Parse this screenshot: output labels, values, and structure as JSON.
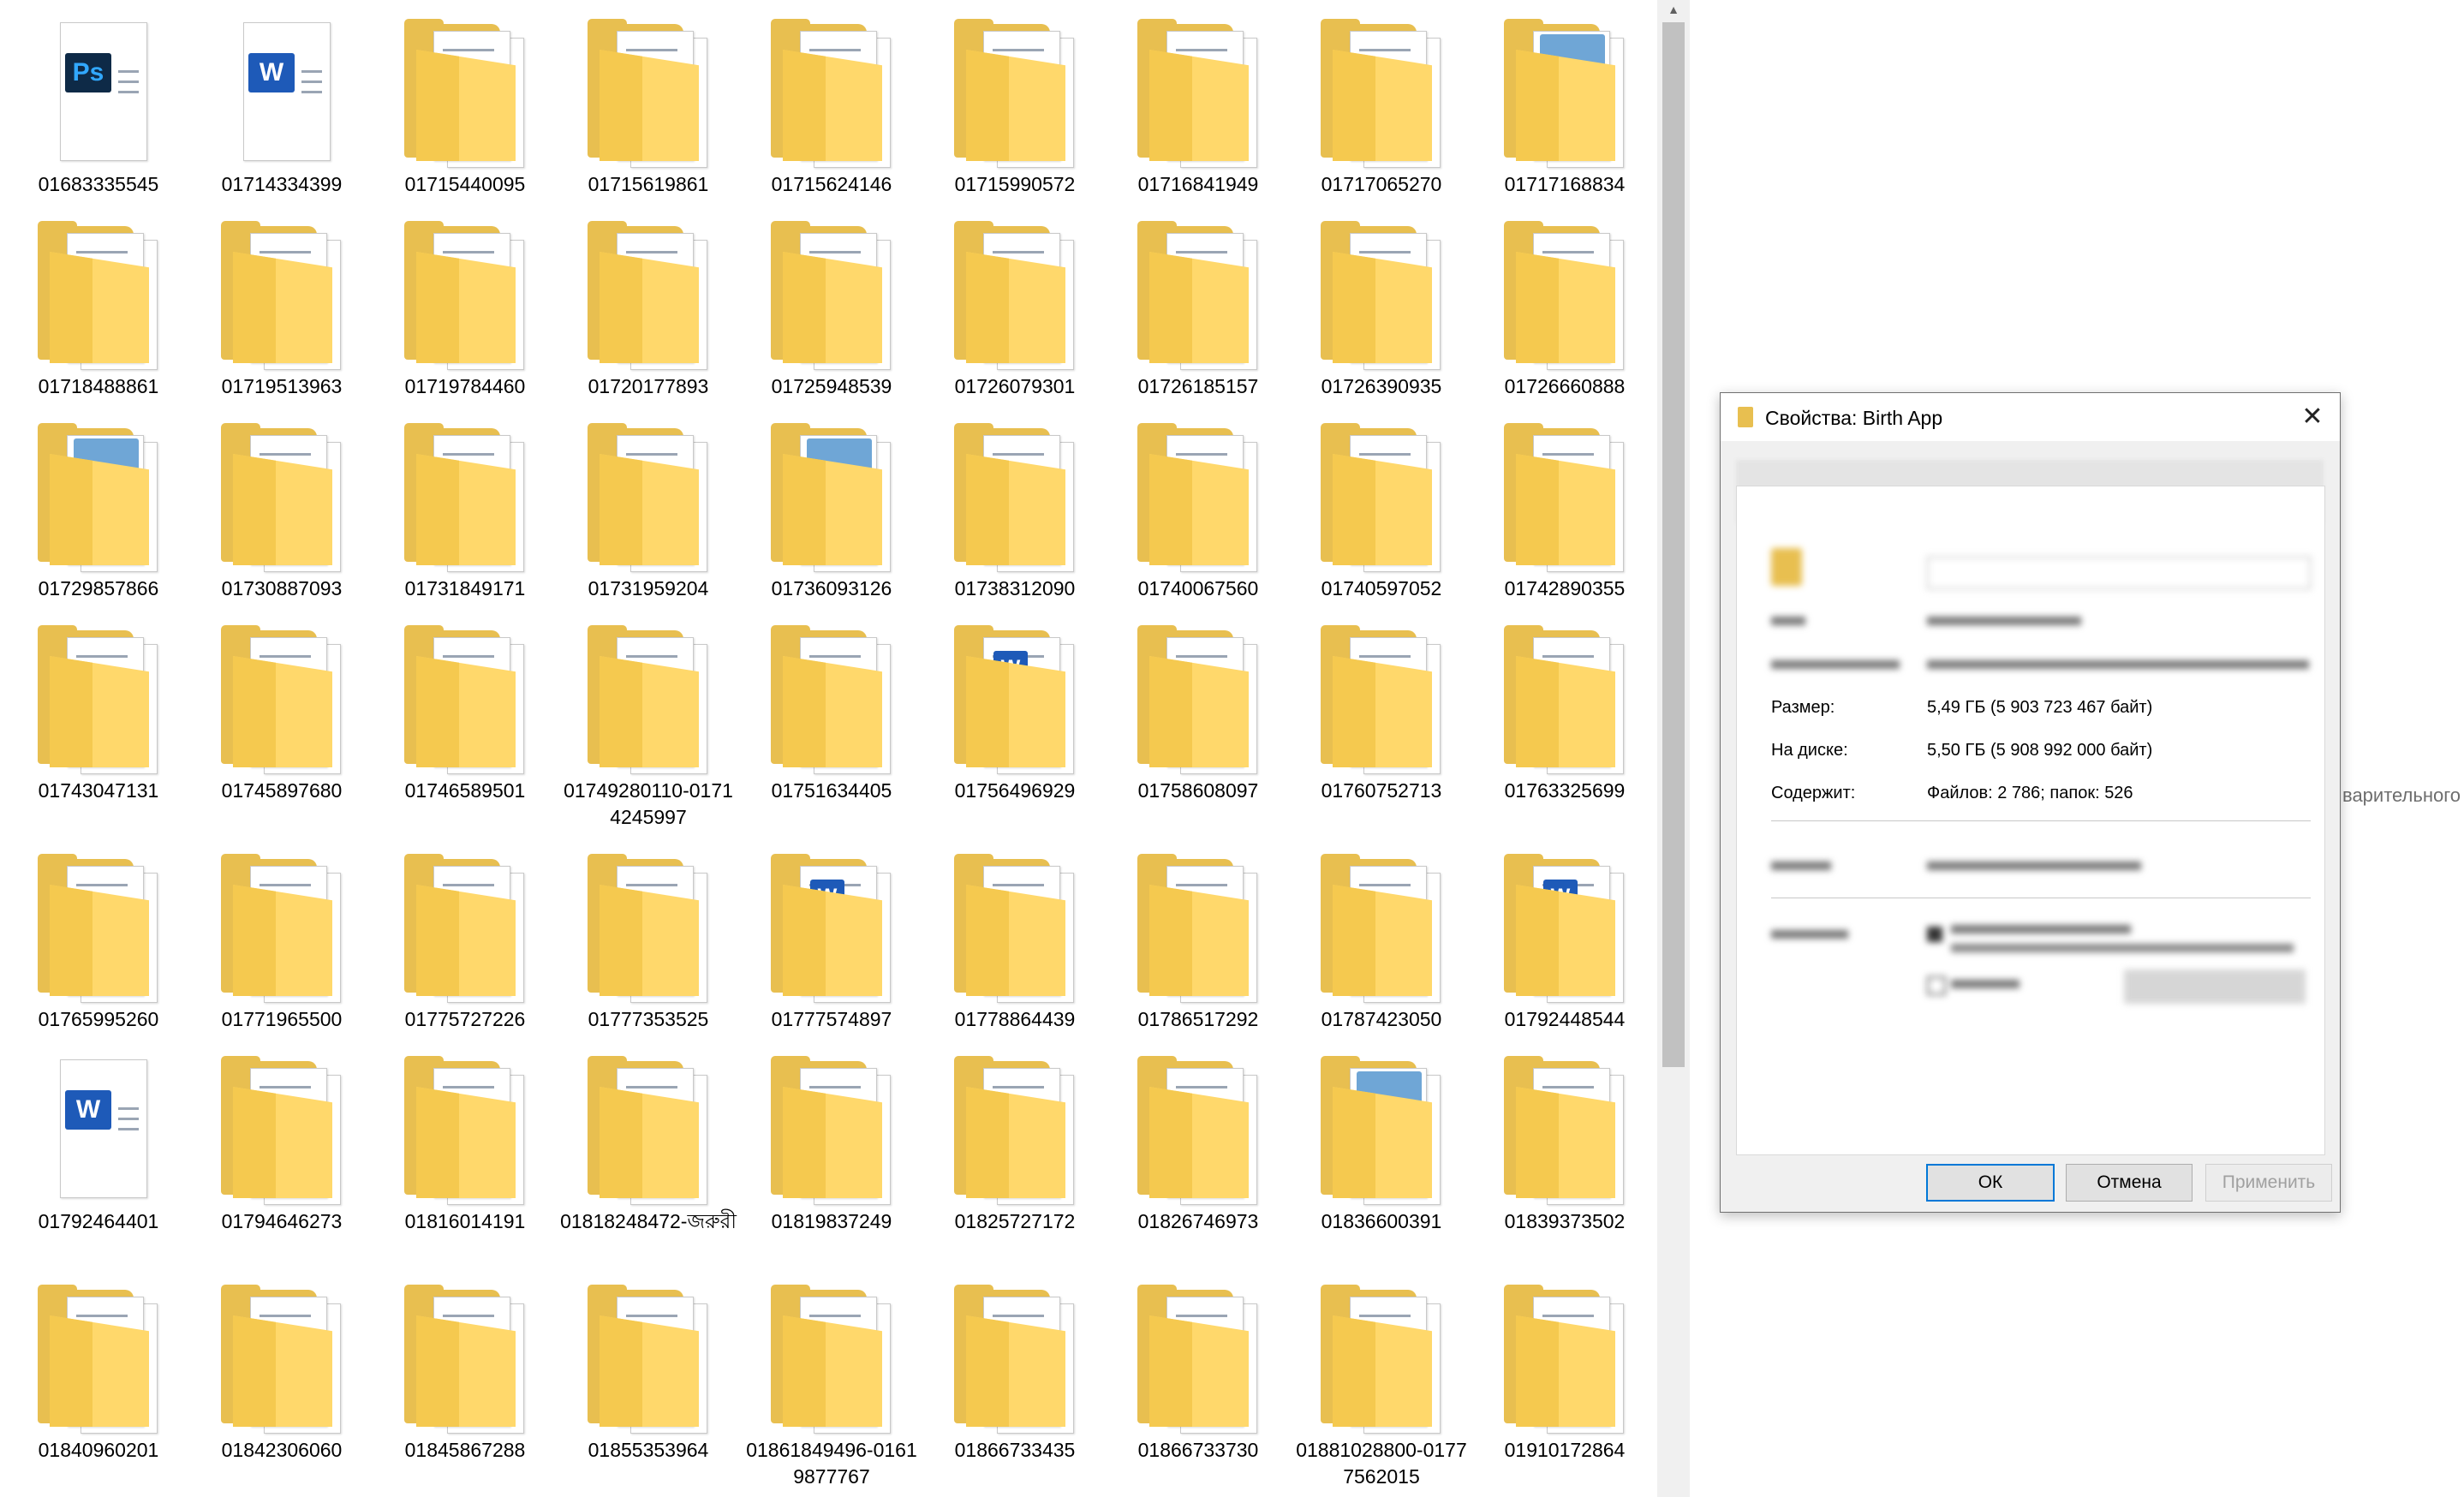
{
  "files": [
    {
      "name": "01683335545",
      "icon": "photoshop-file-icon"
    },
    {
      "name": "01714334399",
      "icon": "word-file-icon"
    },
    {
      "name": "01715440095",
      "icon": "folder-icon"
    },
    {
      "name": "01715619861",
      "icon": "folder-icon"
    },
    {
      "name": "01715624146",
      "icon": "folder-icon"
    },
    {
      "name": "01715990572",
      "icon": "folder-icon"
    },
    {
      "name": "01716841949",
      "icon": "folder-icon"
    },
    {
      "name": "01717065270",
      "icon": "folder-icon"
    },
    {
      "name": "01717168834",
      "icon": "folder-photo-icon"
    },
    {
      "name": "01718488861",
      "icon": "folder-icon"
    },
    {
      "name": "01719513963",
      "icon": "folder-icon"
    },
    {
      "name": "01719784460",
      "icon": "folder-icon"
    },
    {
      "name": "01720177893",
      "icon": "folder-icon"
    },
    {
      "name": "01725948539",
      "icon": "folder-icon"
    },
    {
      "name": "01726079301",
      "icon": "folder-icon"
    },
    {
      "name": "01726185157",
      "icon": "folder-icon"
    },
    {
      "name": "01726390935",
      "icon": "folder-icon"
    },
    {
      "name": "01726660888",
      "icon": "folder-icon"
    },
    {
      "name": "01729857866",
      "icon": "folder-photo-icon"
    },
    {
      "name": "01730887093",
      "icon": "folder-icon"
    },
    {
      "name": "01731849171",
      "icon": "folder-icon"
    },
    {
      "name": "01731959204",
      "icon": "folder-icon"
    },
    {
      "name": "01736093126",
      "icon": "folder-photo-icon"
    },
    {
      "name": "01738312090",
      "icon": "folder-icon"
    },
    {
      "name": "01740067560",
      "icon": "folder-icon"
    },
    {
      "name": "01740597052",
      "icon": "folder-icon"
    },
    {
      "name": "01742890355",
      "icon": "folder-icon"
    },
    {
      "name": "01743047131",
      "icon": "folder-icon"
    },
    {
      "name": "01745897680",
      "icon": "folder-icon"
    },
    {
      "name": "01746589501",
      "icon": "folder-icon"
    },
    {
      "name": "01749280110-01714245997",
      "icon": "folder-icon"
    },
    {
      "name": "01751634405",
      "icon": "folder-icon"
    },
    {
      "name": "01756496929",
      "icon": "folder-word-icon"
    },
    {
      "name": "01758608097",
      "icon": "folder-icon"
    },
    {
      "name": "01760752713",
      "icon": "folder-icon"
    },
    {
      "name": "01763325699",
      "icon": "folder-icon"
    },
    {
      "name": "01765995260",
      "icon": "folder-icon"
    },
    {
      "name": "01771965500",
      "icon": "folder-icon"
    },
    {
      "name": "01775727226",
      "icon": "folder-icon"
    },
    {
      "name": "01777353525",
      "icon": "folder-icon"
    },
    {
      "name": "01777574897",
      "icon": "folder-word-icon"
    },
    {
      "name": "01778864439",
      "icon": "folder-icon"
    },
    {
      "name": "01786517292",
      "icon": "folder-icon"
    },
    {
      "name": "01787423050",
      "icon": "folder-icon"
    },
    {
      "name": "01792448544",
      "icon": "folder-word-icon"
    },
    {
      "name": "01792464401",
      "icon": "word-file-icon"
    },
    {
      "name": "01794646273",
      "icon": "folder-icon"
    },
    {
      "name": "01816014191",
      "icon": "folder-icon"
    },
    {
      "name": "01818248472-জরুরী",
      "icon": "folder-icon"
    },
    {
      "name": "01819837249",
      "icon": "folder-icon"
    },
    {
      "name": "01825727172",
      "icon": "folder-icon"
    },
    {
      "name": "01826746973",
      "icon": "folder-icon"
    },
    {
      "name": "01836600391",
      "icon": "folder-photo-icon"
    },
    {
      "name": "01839373502",
      "icon": "folder-icon"
    },
    {
      "name": "01840960201",
      "icon": "folder-icon"
    },
    {
      "name": "01842306060",
      "icon": "folder-icon"
    },
    {
      "name": "01845867288",
      "icon": "folder-icon"
    },
    {
      "name": "01855353964",
      "icon": "folder-icon"
    },
    {
      "name": "01861849496-01619877767",
      "icon": "folder-icon"
    },
    {
      "name": "01866733435",
      "icon": "folder-icon"
    },
    {
      "name": "01866733730",
      "icon": "folder-icon"
    },
    {
      "name": "01881028800-01777562015",
      "icon": "folder-icon"
    },
    {
      "name": "01910172864",
      "icon": "folder-icon"
    }
  ],
  "side_text": "варительного",
  "dialog": {
    "title": "Свойства: Birth App",
    "close_glyph": "✕",
    "rows": {
      "size_label": "Размер:",
      "size_value": "5,49 ГБ (5 903 723 467 байт)",
      "ondisk_label": "На диске:",
      "ondisk_value": "5,50 ГБ (5 908 992 000 байт)",
      "contains_label": "Содержит:",
      "contains_value": "Файлов: 2 786; папок: 526"
    },
    "buttons": {
      "ok": "ОК",
      "cancel": "Отмена",
      "apply": "Применить"
    }
  },
  "colors": {
    "folder_back": "#e8bf50",
    "folder_front": "#ffd86b",
    "accent": "#0078d7"
  }
}
